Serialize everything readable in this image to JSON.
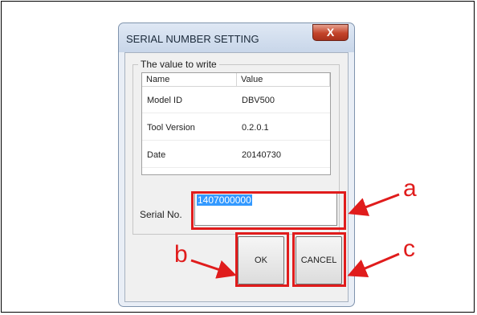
{
  "dialog": {
    "title": "SERIAL NUMBER SETTING",
    "close_glyph": "X",
    "group_label": "The value to write",
    "columns": [
      "Name",
      "Value"
    ],
    "rows": [
      {
        "name": "Model ID",
        "value": "DBV500"
      },
      {
        "name": "Tool Version",
        "value": "0.2.0.1"
      },
      {
        "name": "Date",
        "value": "20140730"
      }
    ],
    "serial_label": "Serial No.",
    "serial_value": "1407000000",
    "ok_label": "OK",
    "cancel_label": "CANCEL"
  },
  "callouts": {
    "a": "a",
    "b": "b",
    "c": "c"
  },
  "colors": {
    "highlight": "#e01c1c",
    "selection": "#3399ff"
  }
}
